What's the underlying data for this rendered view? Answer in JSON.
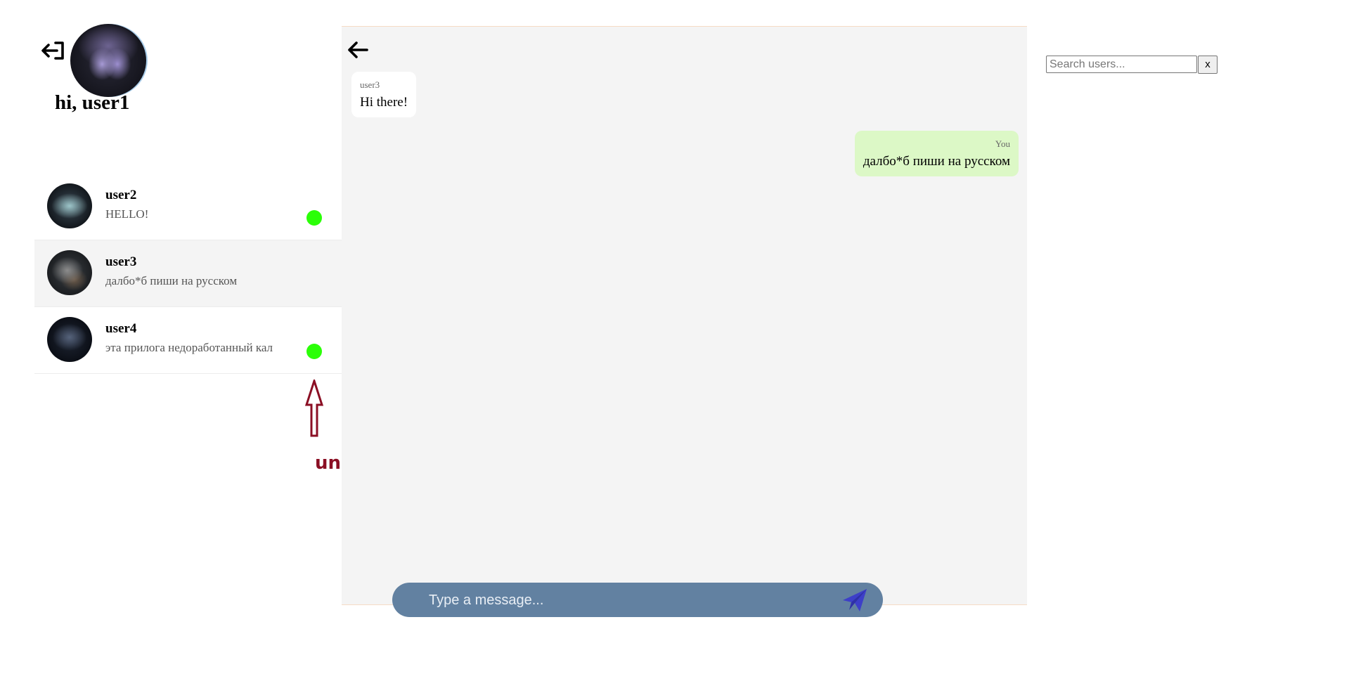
{
  "profile": {
    "greeting": "hi, user1",
    "logout_icon": "logout-icon",
    "avatar_icon": "user-avatar"
  },
  "chats": [
    {
      "name": "user2",
      "preview": "HELLO!",
      "unread": true
    },
    {
      "name": "user3",
      "preview": "далбо*б пиши на русском",
      "unread": false,
      "selected": true
    },
    {
      "name": "user4",
      "preview": "эта прилога недоработанный кал",
      "unread": true
    }
  ],
  "annotation": {
    "label": "unread message",
    "color": "#8b0f24"
  },
  "conversation": {
    "back_icon": "arrow-left-icon",
    "messages": [
      {
        "sender": "user3",
        "text": "Hi there!",
        "direction": "in"
      },
      {
        "sender": "You",
        "text": "далбо*б пиши на русском",
        "direction": "out"
      }
    ]
  },
  "composer": {
    "placeholder": "Type a message...",
    "send_icon": "send-icon"
  },
  "search": {
    "placeholder": "Search users...",
    "clear_label": "x"
  },
  "colors": {
    "unread_dot": "#2bff08",
    "outgoing_bubble": "#dcf8c6",
    "incoming_bubble": "#ffffff",
    "composer_bg": "#6281a1",
    "send_icon": "#3d3fc8",
    "panel_bg": "#f4f4f4"
  }
}
